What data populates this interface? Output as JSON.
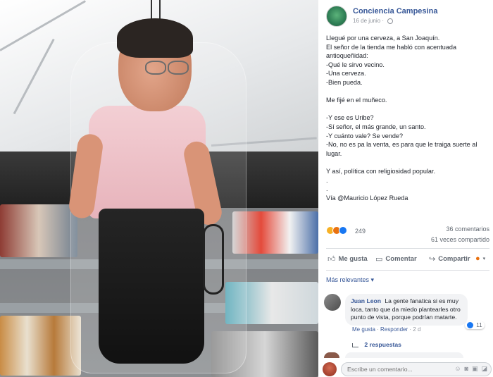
{
  "post": {
    "page_name": "Conciencia Campesina",
    "date": "16 de junio",
    "paragraphs": [
      "Llegué por una cerveza, a San Joaquín.\nEl señor de la tienda me habló con acentuada antioqueñidad:\n-Qué le sirvo vecino.\n-Una cerveza.\n-Bien pueda.",
      "Me fijé en el muñeco.",
      "-Y ese es Uribe?\n-Sí señor, el más grande, un santo.\n-Y cuánto vale? Se vende?\n-No, no es pa la venta, es para que le traiga suerte al lugar.",
      "Y así, política con religiosidad popular.\n.\n.\nVía @Mauricio López Rueda"
    ]
  },
  "stats": {
    "reaction_count": "249",
    "comments": "36 comentarios",
    "shares": "61 veces compartido",
    "reaction_colors": [
      "#f7b125",
      "#e9710f",
      "#1877f2"
    ]
  },
  "actions": {
    "like": "Me gusta",
    "comment": "Comentar",
    "share": "Compartir"
  },
  "filter": {
    "label": "Más relevantes"
  },
  "comment": {
    "author": "Juan Leon",
    "text": "La gente fanatica si es muy loca, tanto que da miedo plantearles otro punto de vista, porque podrían matarte.",
    "like_label": "Me gusta",
    "reply_label": "Responder",
    "age": "2 d",
    "likes": "11"
  },
  "replies": {
    "label": "2 respuestas"
  },
  "composer": {
    "placeholder": "Escribe un comentario..."
  }
}
